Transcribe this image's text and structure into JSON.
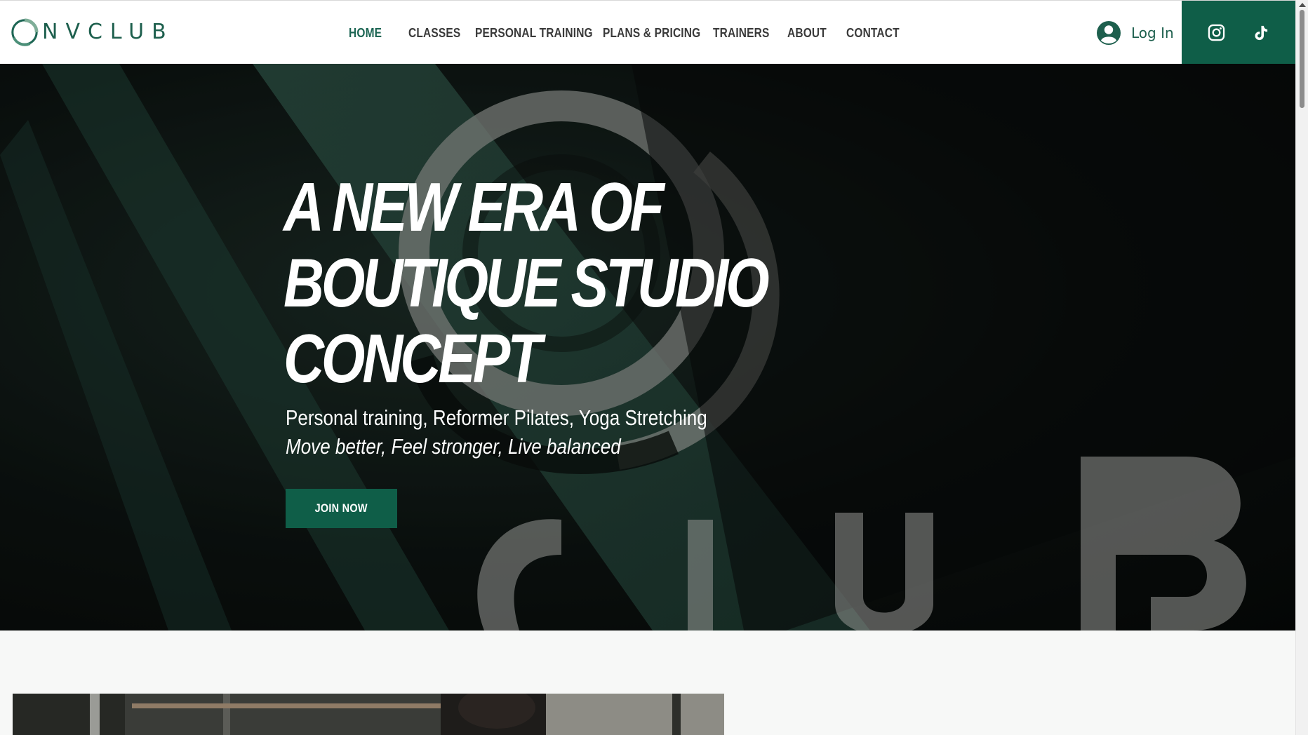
{
  "brand": {
    "logo_text": "NVCLUB",
    "accent_color": "#0f5e48",
    "text_color": "#1d5f4d"
  },
  "nav": {
    "items": [
      {
        "label": "HOME",
        "active": true
      },
      {
        "label": "CLASSES",
        "active": false
      },
      {
        "label": "PERSONAL TRAINING",
        "active": false
      },
      {
        "label": "PLANS & PRICING",
        "active": false
      },
      {
        "label": "TRAINERS",
        "active": false
      },
      {
        "label": "ABOUT",
        "active": false
      },
      {
        "label": "CONTACT",
        "active": false
      }
    ]
  },
  "account": {
    "login_label": "Log In",
    "icon": "user-avatar-icon"
  },
  "social": {
    "icons": [
      "instagram-icon",
      "tiktok-icon"
    ]
  },
  "hero": {
    "title_lines": [
      "A NEW ERA OF",
      "BOUTIQUE STUDIO",
      "CONCEPT"
    ],
    "subtitle": "Personal training, Reformer Pilates, Yoga Stretching",
    "tagline": "Move better, Feel stronger, Live balanced",
    "cta_label": "JOIN NOW",
    "background_letters": "CLUB"
  }
}
